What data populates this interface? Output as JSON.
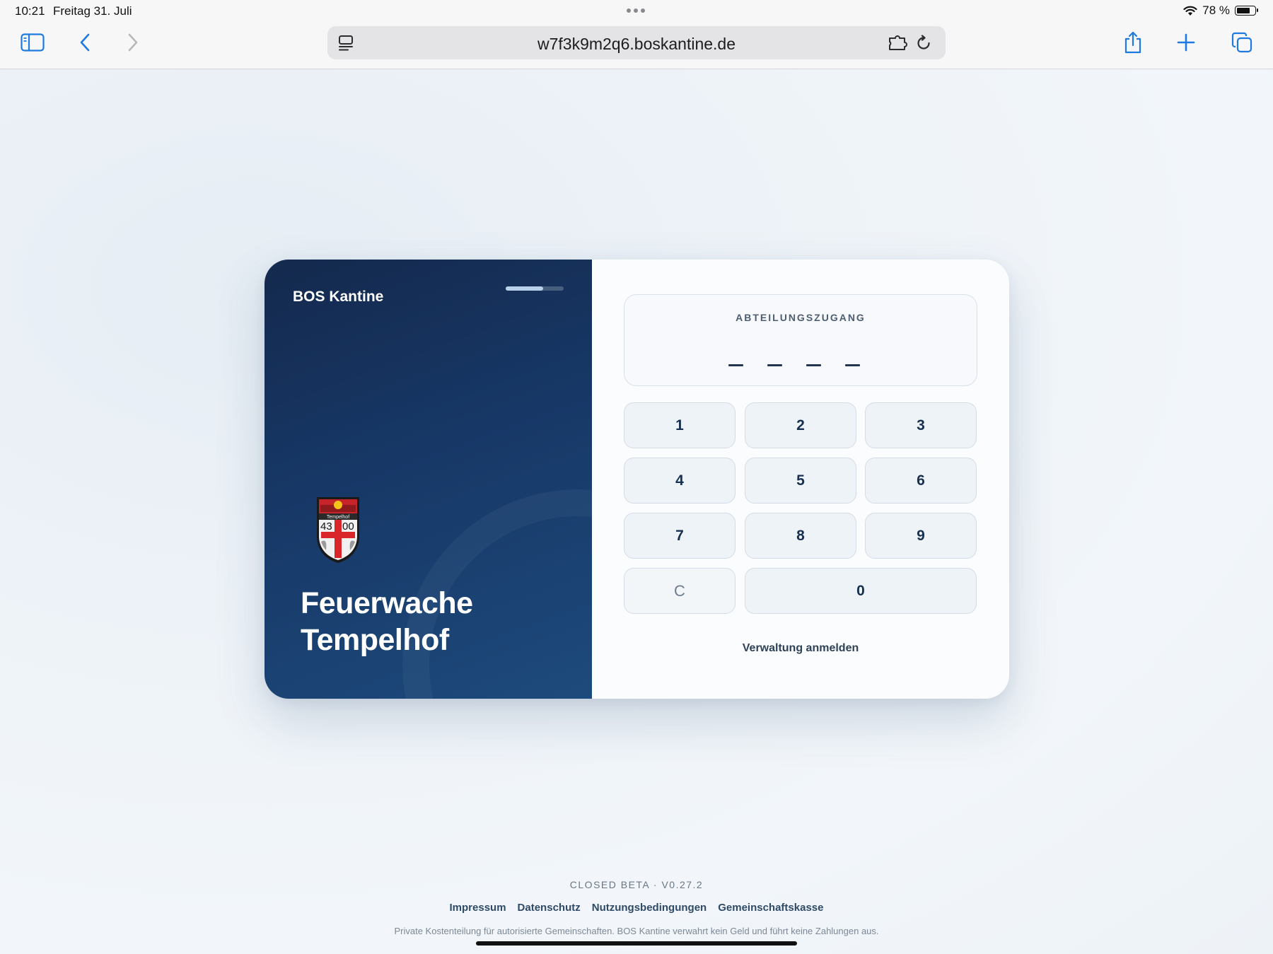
{
  "statusbar": {
    "time": "10:21",
    "date": "Freitag 31. Juli",
    "battery_text": "78 %",
    "battery_level": 0.78,
    "icons": [
      "more-dots-icon",
      "wifi-icon",
      "battery-icon"
    ]
  },
  "browser": {
    "url": "w7f3k9m2q6.boskantine.de",
    "accent_color": "#1f7ae0",
    "icons": [
      "sidebar-icon",
      "back-icon",
      "forward-icon",
      "reader-icon",
      "extension-icon",
      "reload-icon",
      "share-icon",
      "new-tab-icon",
      "tabs-icon"
    ]
  },
  "card": {
    "brand": "BOS Kantine",
    "step_progress": 0.65,
    "crest": {
      "text_top": "Tempelhof",
      "text_left": "43",
      "text_right": "00"
    },
    "station_line1": "Feuerwache",
    "station_line2": "Tempelhof",
    "pin": {
      "label": "ABTEILUNGSZUGANG",
      "length": 4,
      "entered": ""
    },
    "keypad": {
      "k1": "1",
      "k2": "2",
      "k3": "3",
      "k4": "4",
      "k5": "5",
      "k6": "6",
      "k7": "7",
      "k8": "8",
      "k9": "9",
      "clear": "C",
      "k0": "0"
    },
    "admin_link": "Verwaltung anmelden"
  },
  "footer": {
    "beta": "CLOSED BETA · V0.27.2",
    "links": {
      "impressum": "Impressum",
      "datenschutz": "Datenschutz",
      "nutzung": "Nutzungsbedingungen",
      "kasse": "Gemeinschaftskasse"
    },
    "disclaimer": "Private Kostenteilung für autorisierte Gemeinschaften. BOS Kantine verwahrt kein Geld und führt keine Zahlungen aus."
  },
  "colors": {
    "panel_dark": "#14294d",
    "panel_mid": "#1d4a7c",
    "key_bg": "#eef3f7",
    "crest_red": "#d8262b"
  }
}
